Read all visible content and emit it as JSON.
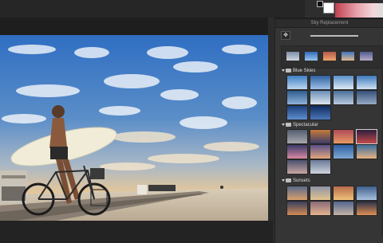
{
  "panel": {
    "title": "Sky Replacement",
    "move_icon": "move-icon",
    "groups": [
      {
        "name": "Blue Skies",
        "thumbs": [
          {
            "top": "#3f7fc4",
            "bottom": "#bcd6ef"
          },
          {
            "top": "#2f5f9f",
            "bottom": "#9fc3e8"
          },
          {
            "top": "#5a8fca",
            "bottom": "#dfe9f4"
          },
          {
            "top": "#3d79bf",
            "bottom": "#cfe1f2"
          },
          {
            "top": "#2d5c8f",
            "bottom": "#8fb2d8"
          },
          {
            "top": "#6b8fb8",
            "bottom": "#dde4ee"
          },
          {
            "top": "#4a6f9a",
            "bottom": "#b9c9dd"
          },
          {
            "top": "#33507a",
            "bottom": "#98a9c3"
          },
          {
            "top": "#1b3f7a",
            "bottom": "#5f8fd0"
          },
          {
            "top": "#0f2c5e",
            "bottom": "#4b77b8"
          }
        ]
      },
      {
        "name": "Spectacular",
        "thumbs": [
          {
            "top": "#545c6e",
            "bottom": "#a7a8b0"
          },
          {
            "top": "#c77a3a",
            "bottom": "#3c3c6a"
          },
          {
            "top": "#b04a58",
            "bottom": "#e79a63"
          },
          {
            "top": "#2c1f3e",
            "bottom": "#c44a4a"
          },
          {
            "top": "#3a3a6a",
            "bottom": "#d889a0"
          },
          {
            "top": "#5a4f8a",
            "bottom": "#e3a77c"
          },
          {
            "top": "#2e5fa2",
            "bottom": "#7fa8d4"
          },
          {
            "top": "#3c6f9e",
            "bottom": "#e5b281"
          },
          {
            "top": "#4a5070",
            "bottom": "#c9a6a0"
          },
          {
            "top": "#6a7a98",
            "bottom": "#cfd4dc"
          }
        ]
      },
      {
        "name": "Sunsets",
        "thumbs": [
          {
            "top": "#5b6a8a",
            "bottom": "#d8a06b"
          },
          {
            "top": "#8e93a6",
            "bottom": "#e3c48f"
          },
          {
            "top": "#b76b4a",
            "bottom": "#f0c07a"
          },
          {
            "top": "#3f5f8c",
            "bottom": "#a9c1de"
          },
          {
            "top": "#37405e",
            "bottom": "#d48a56"
          },
          {
            "top": "#8a6a78",
            "bottom": "#e4b38e"
          },
          {
            "top": "#52668e",
            "bottom": "#c6b3a6"
          },
          {
            "top": "#2a2f48",
            "bottom": "#e08f54"
          }
        ]
      }
    ],
    "featured": [
      {
        "top": "#7c8ea6",
        "bottom": "#cfd6df"
      },
      {
        "top": "#2f6bbd",
        "bottom": "#9ac4ee"
      },
      {
        "top": "#b25a4c",
        "bottom": "#f1a46a"
      },
      {
        "top": "#3d74c0",
        "bottom": "#e2b891"
      },
      {
        "top": "#4d5d8d",
        "bottom": "#b9a7c9"
      }
    ]
  },
  "colors": {
    "foreground": "#ffffff",
    "gradient_start": "#c24151"
  }
}
